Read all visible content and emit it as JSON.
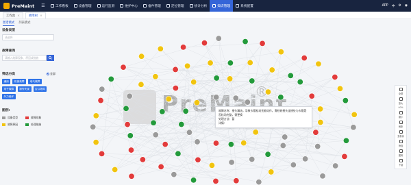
{
  "app": {
    "name": "PreMaint",
    "menu_icon": "hamburger-icon"
  },
  "nav": [
    {
      "label": "工作看板",
      "icon": "home-icon",
      "active": false
    },
    {
      "label": "设备管理",
      "icon": "device-icon",
      "active": false
    },
    {
      "label": "运行监测",
      "icon": "monitor-icon",
      "active": false
    },
    {
      "label": "维护中心",
      "icon": "wrench-icon",
      "active": false
    },
    {
      "label": "备件管理",
      "icon": "box-icon",
      "active": false
    },
    {
      "label": "定位管理",
      "icon": "location-icon",
      "active": false
    },
    {
      "label": "统计分析",
      "icon": "chart-icon",
      "active": false
    },
    {
      "label": "知识管理",
      "icon": "book-icon",
      "active": true
    },
    {
      "label": "系统配置",
      "icon": "gear-icon",
      "active": false
    }
  ],
  "header_right": {
    "app_label": "APP",
    "lang_label": "中"
  },
  "tabs": [
    {
      "label": "工作台",
      "closable": true,
      "active": false
    },
    {
      "label": "故障树",
      "closable": true,
      "active": true
    }
  ],
  "view_tabs": [
    {
      "label": "图谱模式",
      "active": true
    },
    {
      "label": "列表模式",
      "active": false
    }
  ],
  "filters": {
    "device_type_label": "设备类型",
    "device_type_placeholder": "请选择",
    "fault_search_label": "故障查询",
    "fault_search_placeholder": "请输入故障现象、原因或措施",
    "filter_label": "筛选分类",
    "filter_radio_label": "全部",
    "chips": [
      "通用",
      "机械故障",
      "电气故障",
      "电子故障",
      "操作失误",
      "应以故障",
      "外力破坏"
    ]
  },
  "legend": {
    "title": "图例:",
    "items": [
      {
        "label": "设备类型",
        "color": "#9a9a9a"
      },
      {
        "label": "故障现象",
        "color": "#e23b3b"
      },
      {
        "label": "故障原因",
        "color": "#f1c40f"
      },
      {
        "label": "处理措施",
        "color": "#239a3b"
      }
    ]
  },
  "tooltip": {
    "line1": "故障名称：接头漏油，导致卡箍松动无能动作，需检修接头连接处与卡箍是否松动完整，需更换",
    "line2": "处理方法：暂",
    "line3": "详情："
  },
  "graph_toolbar": [
    {
      "label": "全屏",
      "icon": "fullscreen-icon"
    },
    {
      "label": "放大",
      "icon": "zoom-in-icon"
    },
    {
      "label": "缩小",
      "icon": "zoom-out-icon"
    },
    {
      "label": "刷新",
      "icon": "refresh-icon"
    },
    {
      "label": "查看树",
      "icon": "tree-icon"
    },
    {
      "label": "筛选",
      "icon": "filter-icon"
    },
    {
      "label": "图例",
      "icon": "legend-icon"
    },
    {
      "label": "下载",
      "icon": "download-icon"
    }
  ],
  "zoom_percent": "40%",
  "watermark": {
    "text": "PreMaint",
    "reg": "®"
  },
  "colors": {
    "device": "#9a9a9a",
    "phenomenon": "#e23b3b",
    "cause": "#f1c40f",
    "measure": "#239a3b",
    "accent": "#3565d8",
    "nav_bg": "#18243f"
  }
}
